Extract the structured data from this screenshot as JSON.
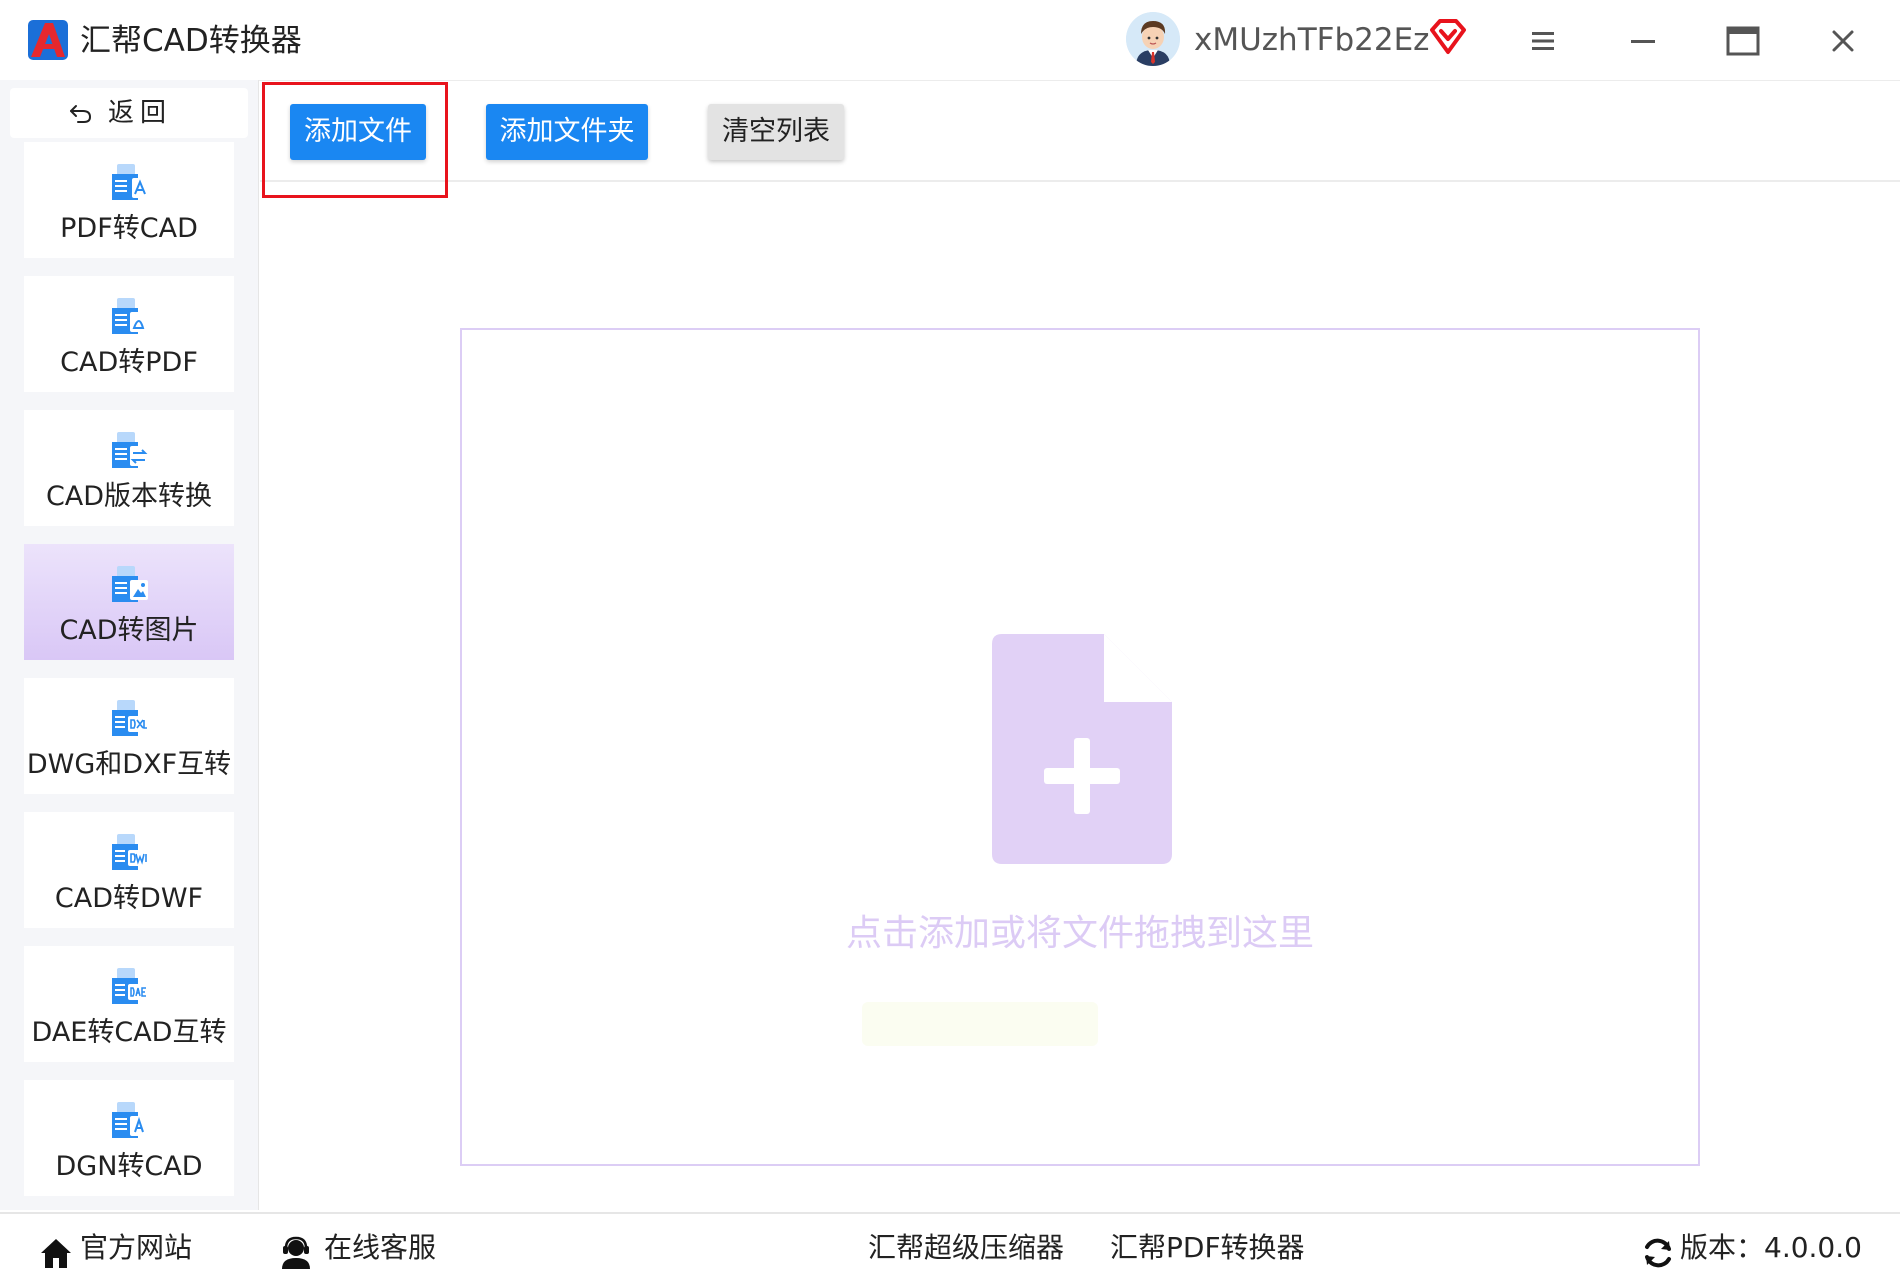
{
  "app": {
    "title": "汇帮CAD转换器",
    "username": "xMUzhTFb22Ez"
  },
  "window_controls": [
    "menu-icon",
    "minimize-icon",
    "maximize-icon",
    "close-icon"
  ],
  "sidebar": {
    "back_label": "返回",
    "items": [
      {
        "label": "PDF转CAD",
        "icon": "pdf-to-cad-icon",
        "active": false
      },
      {
        "label": "CAD转PDF",
        "icon": "cad-to-pdf-icon",
        "active": false
      },
      {
        "label": "CAD版本转换",
        "icon": "cad-version-icon",
        "active": false
      },
      {
        "label": "CAD转图片",
        "icon": "cad-to-image-icon",
        "active": true
      },
      {
        "label": "DWG和DXF互转",
        "icon": "dwg-dxf-icon",
        "active": false
      },
      {
        "label": "CAD转DWF",
        "icon": "cad-to-dwf-icon",
        "active": false
      },
      {
        "label": "DAE转CAD互转",
        "icon": "dae-cad-icon",
        "active": false
      },
      {
        "label": "DGN转CAD",
        "icon": "dgn-to-cad-icon",
        "active": false
      }
    ]
  },
  "toolbar": {
    "add_file": "添加文件",
    "add_folder": "添加文件夹",
    "clear_list": "清空列表"
  },
  "dropzone": {
    "hint": "点击添加或将文件拖拽到这里"
  },
  "footer": {
    "website": "官方网站",
    "support": "在线客服",
    "compressor": "汇帮超级压缩器",
    "pdf_converter": "汇帮PDF转换器",
    "version": "版本：4.0.0.0"
  },
  "colors": {
    "primary_blue": "#1a87f2",
    "active_purple": "#d9c7f6",
    "highlight_red": "#e8131c",
    "drop_purple": "#e1d1f6"
  }
}
